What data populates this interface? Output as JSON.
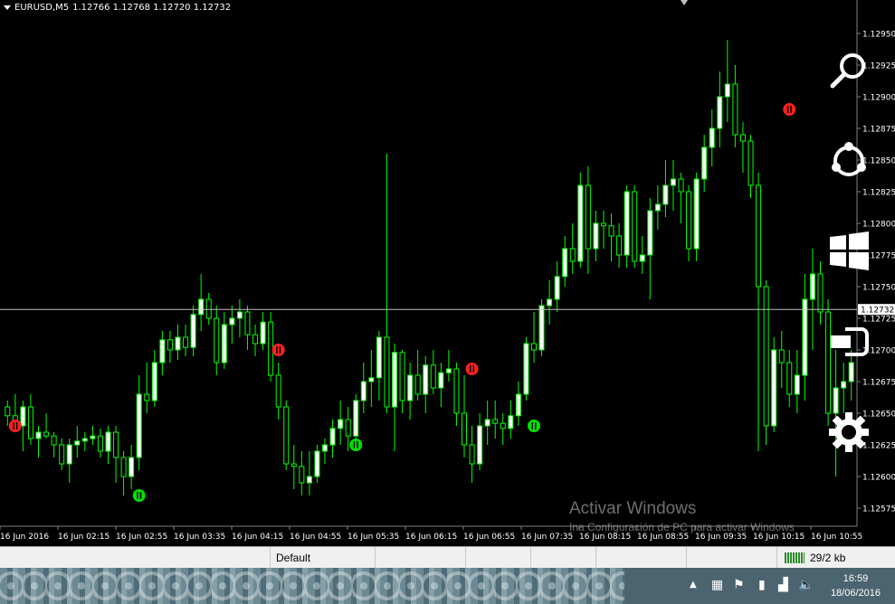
{
  "header": {
    "symbol": "EURUSD,M5",
    "prices": "1.12766 1.12768 1.12720 1.12732"
  },
  "price_axis": {
    "labels": [
      "1.12950",
      "1.12925",
      "1.12900",
      "1.12875",
      "1.12850",
      "1.12825",
      "1.12800",
      "1.12775",
      "1.12750",
      "1.12725",
      "1.12700",
      "1.12675",
      "1.12650",
      "1.12625",
      "1.12600",
      "1.12575"
    ],
    "current_price": "1.12732",
    "current_value": 1.12732
  },
  "time_axis": {
    "labels": [
      "16 Jun 2016",
      "16 Jun 02:15",
      "16 Jun 02:55",
      "16 Jun 03:35",
      "16 Jun 04:15",
      "16 Jun 04:55",
      "16 Jun 05:35",
      "16 Jun 06:15",
      "16 Jun 06:55",
      "16 Jun 07:35",
      "16 Jun 08:15",
      "16 Jun 08:55",
      "16 Jun 09:35",
      "16 Jun 10:15",
      "16 Jun 10:55"
    ]
  },
  "chart_data": {
    "type": "candlestick",
    "symbol": "EURUSD",
    "timeframe": "M5",
    "ylim": [
      1.12565,
      1.12965
    ],
    "candles": [
      [
        1.12655,
        1.1266,
        1.1264,
        1.12648
      ],
      [
        1.12648,
        1.12665,
        1.12635,
        1.1264
      ],
      [
        1.1264,
        1.1266,
        1.1262,
        1.12655
      ],
      [
        1.12655,
        1.12665,
        1.12625,
        1.1263
      ],
      [
        1.1263,
        1.1264,
        1.12615,
        1.12635
      ],
      [
        1.12635,
        1.1265,
        1.1263,
        1.12632
      ],
      [
        1.12632,
        1.12635,
        1.12615,
        1.12625
      ],
      [
        1.12625,
        1.1263,
        1.12605,
        1.1261
      ],
      [
        1.1261,
        1.1263,
        1.12595,
        1.12625
      ],
      [
        1.12625,
        1.1264,
        1.12615,
        1.12628
      ],
      [
        1.12628,
        1.12635,
        1.1262,
        1.1263
      ],
      [
        1.1263,
        1.1264,
        1.12625,
        1.12632
      ],
      [
        1.12632,
        1.12638,
        1.12615,
        1.1262
      ],
      [
        1.1262,
        1.1264,
        1.1261,
        1.12635
      ],
      [
        1.12635,
        1.1264,
        1.12595,
        1.12615
      ],
      [
        1.12615,
        1.1262,
        1.12585,
        1.126
      ],
      [
        1.126,
        1.12625,
        1.1259,
        1.12615
      ],
      [
        1.12615,
        1.1268,
        1.12605,
        1.12665
      ],
      [
        1.12665,
        1.1269,
        1.1265,
        1.1266
      ],
      [
        1.1266,
        1.127,
        1.12655,
        1.1269
      ],
      [
        1.1269,
        1.12715,
        1.1268,
        1.12708
      ],
      [
        1.12708,
        1.12715,
        1.1269,
        1.127
      ],
      [
        1.127,
        1.1272,
        1.12692,
        1.1271
      ],
      [
        1.1271,
        1.1272,
        1.12695,
        1.12702
      ],
      [
        1.12702,
        1.12735,
        1.12695,
        1.12728
      ],
      [
        1.12728,
        1.1276,
        1.12715,
        1.1274
      ],
      [
        1.1274,
        1.12745,
        1.1272,
        1.12725
      ],
      [
        1.12725,
        1.12735,
        1.1268,
        1.1269
      ],
      [
        1.1269,
        1.1273,
        1.12685,
        1.1272
      ],
      [
        1.1272,
        1.12735,
        1.12705,
        1.12725
      ],
      [
        1.12725,
        1.1274,
        1.1271,
        1.1273
      ],
      [
        1.1273,
        1.12735,
        1.127,
        1.12712
      ],
      [
        1.12712,
        1.1272,
        1.12695,
        1.12705
      ],
      [
        1.12705,
        1.1273,
        1.127,
        1.12722
      ],
      [
        1.12722,
        1.1273,
        1.12675,
        1.1268
      ],
      [
        1.1268,
        1.1269,
        1.12645,
        1.12655
      ],
      [
        1.12655,
        1.1266,
        1.12605,
        1.1261
      ],
      [
        1.1261,
        1.12625,
        1.1259,
        1.12608
      ],
      [
        1.12608,
        1.1262,
        1.12585,
        1.12595
      ],
      [
        1.12595,
        1.1262,
        1.12585,
        1.126
      ],
      [
        1.126,
        1.12625,
        1.12595,
        1.1262
      ],
      [
        1.1262,
        1.1263,
        1.1261,
        1.12625
      ],
      [
        1.12625,
        1.12645,
        1.12615,
        1.12638
      ],
      [
        1.12638,
        1.1266,
        1.12625,
        1.12645
      ],
      [
        1.12645,
        1.12655,
        1.1262,
        1.12632
      ],
      [
        1.12632,
        1.12665,
        1.12625,
        1.1266
      ],
      [
        1.1266,
        1.1269,
        1.1265,
        1.12675
      ],
      [
        1.12675,
        1.127,
        1.12655,
        1.12678
      ],
      [
        1.12678,
        1.12715,
        1.1266,
        1.1271
      ],
      [
        1.1271,
        1.12855,
        1.1265,
        1.12655
      ],
      [
        1.12655,
        1.12705,
        1.1262,
        1.12698
      ],
      [
        1.12698,
        1.127,
        1.1265,
        1.1266
      ],
      [
        1.1266,
        1.1269,
        1.12645,
        1.1268
      ],
      [
        1.1268,
        1.127,
        1.1266,
        1.12665
      ],
      [
        1.12665,
        1.12695,
        1.1265,
        1.12688
      ],
      [
        1.12688,
        1.127,
        1.12665,
        1.1267
      ],
      [
        1.1267,
        1.1269,
        1.12655,
        1.12682
      ],
      [
        1.12682,
        1.127,
        1.12675,
        1.12685
      ],
      [
        1.12685,
        1.1269,
        1.1264,
        1.1265
      ],
      [
        1.1265,
        1.1268,
        1.12615,
        1.12625
      ],
      [
        1.12625,
        1.1264,
        1.12595,
        1.1261
      ],
      [
        1.1261,
        1.1265,
        1.12605,
        1.1264
      ],
      [
        1.1264,
        1.1266,
        1.12625,
        1.12645
      ],
      [
        1.12645,
        1.1266,
        1.1263,
        1.12642
      ],
      [
        1.12642,
        1.1265,
        1.12625,
        1.12638
      ],
      [
        1.12638,
        1.1266,
        1.1263,
        1.12648
      ],
      [
        1.12648,
        1.12675,
        1.1264,
        1.12665
      ],
      [
        1.12665,
        1.1271,
        1.1266,
        1.12705
      ],
      [
        1.12705,
        1.1273,
        1.1269,
        1.127
      ],
      [
        1.127,
        1.1274,
        1.12695,
        1.12735
      ],
      [
        1.12735,
        1.12755,
        1.1272,
        1.1274
      ],
      [
        1.1274,
        1.1277,
        1.1273,
        1.12758
      ],
      [
        1.12758,
        1.1279,
        1.1275,
        1.1278
      ],
      [
        1.1278,
        1.128,
        1.1276,
        1.1277
      ],
      [
        1.1277,
        1.1284,
        1.12765,
        1.1283
      ],
      [
        1.1283,
        1.12845,
        1.1276,
        1.1278
      ],
      [
        1.1278,
        1.1281,
        1.1277,
        1.128
      ],
      [
        1.128,
        1.1281,
        1.1278,
        1.12798
      ],
      [
        1.12798,
        1.12808,
        1.1277,
        1.1279
      ],
      [
        1.1279,
        1.128,
        1.12765,
        1.12775
      ],
      [
        1.12775,
        1.1283,
        1.12765,
        1.12825
      ],
      [
        1.12825,
        1.1283,
        1.12765,
        1.1277
      ],
      [
        1.1277,
        1.1279,
        1.1276,
        1.12775
      ],
      [
        1.12775,
        1.1282,
        1.1274,
        1.1281
      ],
      [
        1.1281,
        1.1283,
        1.12795,
        1.12815
      ],
      [
        1.12815,
        1.1285,
        1.12805,
        1.1283
      ],
      [
        1.1283,
        1.1285,
        1.1281,
        1.12835
      ],
      [
        1.12835,
        1.1284,
        1.128,
        1.12825
      ],
      [
        1.12825,
        1.1283,
        1.1277,
        1.1278
      ],
      [
        1.1278,
        1.1284,
        1.1277,
        1.12835
      ],
      [
        1.12835,
        1.1287,
        1.12825,
        1.1286
      ],
      [
        1.1286,
        1.1289,
        1.12845,
        1.12875
      ],
      [
        1.12875,
        1.1292,
        1.1286,
        1.129
      ],
      [
        1.129,
        1.12945,
        1.1288,
        1.1291
      ],
      [
        1.1291,
        1.12925,
        1.1286,
        1.1287
      ],
      [
        1.1287,
        1.1288,
        1.1284,
        1.12865
      ],
      [
        1.12865,
        1.1287,
        1.1282,
        1.1283
      ],
      [
        1.1283,
        1.1284,
        1.1262,
        1.1275
      ],
      [
        1.1275,
        1.12755,
        1.12625,
        1.1264
      ],
      [
        1.1264,
        1.1271,
        1.12635,
        1.127
      ],
      [
        1.127,
        1.12715,
        1.1267,
        1.1269
      ],
      [
        1.1269,
        1.127,
        1.12655,
        1.12665
      ],
      [
        1.12665,
        1.127,
        1.1265,
        1.1268
      ],
      [
        1.1268,
        1.1276,
        1.1266,
        1.1274
      ],
      [
        1.1274,
        1.1278,
        1.127,
        1.1276
      ],
      [
        1.1276,
        1.1277,
        1.1272,
        1.1273
      ],
      [
        1.1273,
        1.1274,
        1.1264,
        1.1265
      ],
      [
        1.1265,
        1.127,
        1.126,
        1.1267
      ],
      [
        1.1267,
        1.1269,
        1.1265,
        1.12675
      ],
      [
        1.12675,
        1.127,
        1.1266,
        1.1269
      ]
    ]
  },
  "signals": [
    {
      "type": "sell",
      "index": 1,
      "price": 1.1264
    },
    {
      "type": "buy",
      "index": 17,
      "price": 1.12585
    },
    {
      "type": "sell",
      "index": 35,
      "price": 1.127
    },
    {
      "type": "buy",
      "index": 45,
      "price": 1.12625
    },
    {
      "type": "sell",
      "index": 60,
      "price": 1.12685
    },
    {
      "type": "buy",
      "index": 68,
      "price": 1.1264
    },
    {
      "type": "sell",
      "index": 101,
      "price": 1.1289
    }
  ],
  "colors": {
    "bull_body": "#ffffff",
    "bear_body": "#000000",
    "wick": "#00ff00",
    "sell_signal": "#ff2020",
    "buy_signal": "#00e000",
    "bid_line": "#c0c0c0",
    "axis_text": "#ffffff"
  },
  "charms": [
    {
      "name": "search-icon"
    },
    {
      "name": "share-icon"
    },
    {
      "name": "start-icon"
    },
    {
      "name": "devices-icon"
    },
    {
      "name": "settings-icon"
    }
  ],
  "status_bar": {
    "profile": "Default",
    "connection": "29/2 kb"
  },
  "taskbar": {
    "tray_icons": [
      "chevron-up-icon",
      "network-icon",
      "flag-icon",
      "battery-icon",
      "signal-icon",
      "volume-icon"
    ],
    "time": "16:59",
    "date": "18/06/2016"
  },
  "watermark": {
    "title": "Activar Windows",
    "subtitle": "Ina Configuración de PC para activar Windows"
  }
}
